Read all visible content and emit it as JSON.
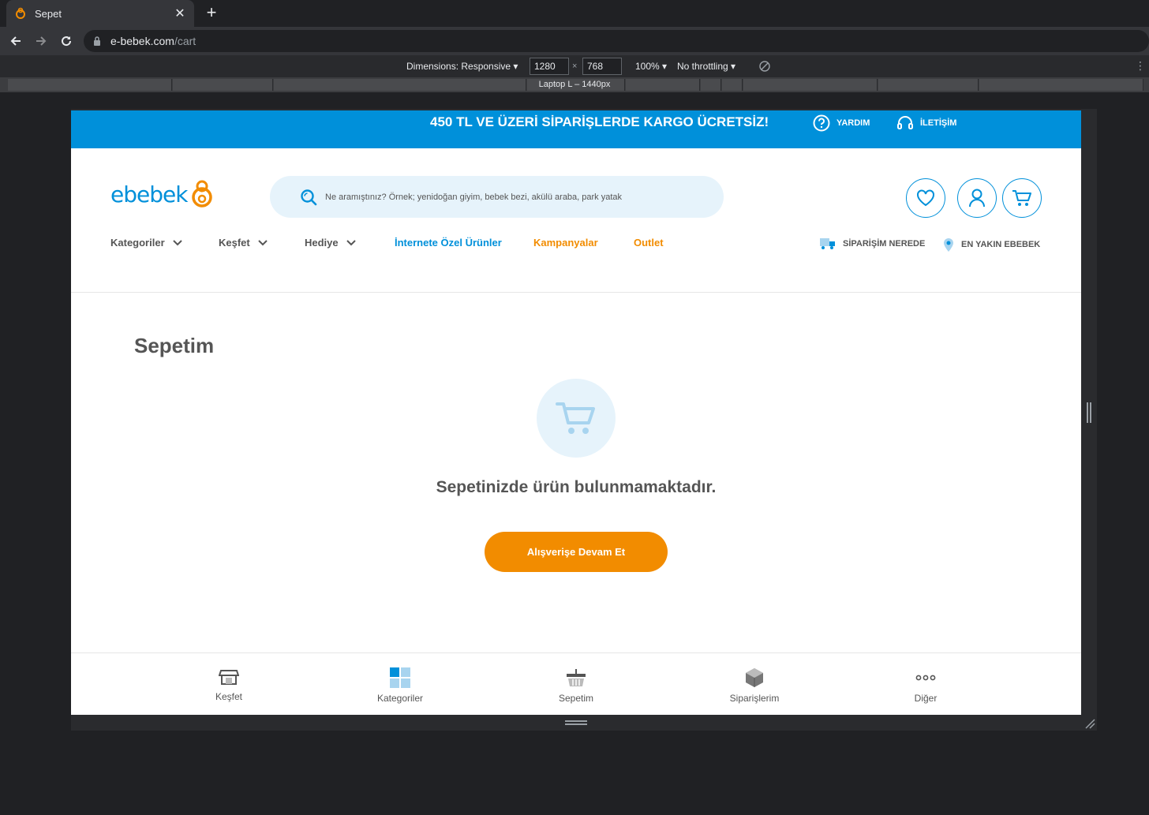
{
  "browser": {
    "tab_title": "Sepet",
    "url_host": "e-bebek.com",
    "url_path": "/cart"
  },
  "devtools": {
    "dimensions_label": "Dimensions: Responsive ▾",
    "width": "1280",
    "height": "768",
    "times": "×",
    "zoom": "100% ▾",
    "throttling": "No throttling ▾",
    "breakpoint_label": "Laptop L – 1440px"
  },
  "promo": {
    "text": "450 TL VE ÜZERİ SİPARİŞLERDE KARGO ÜCRETSİZ!",
    "help": "YARDIM",
    "contact": "İLETİŞİM"
  },
  "header": {
    "logo": "ebebek",
    "search_placeholder": "Ne aramıştınız? Örnek; yenidoğan giyim, bebek bezi, akülü araba, park yatak"
  },
  "nav": {
    "categories": "Kategoriler",
    "discover": "Keşfet",
    "gift": "Hediye",
    "online_exclusive": "İnternete Özel Ürünler",
    "campaigns": "Kampanyalar",
    "outlet": "Outlet",
    "order_tracking": "SİPARİŞİM NEREDE",
    "nearest_store": "EN YAKIN EBEBEK"
  },
  "cart": {
    "title": "Sepetim",
    "empty_message": "Sepetinizde ürün bulunmamaktadır.",
    "continue_button": "Alışverişe Devam Et"
  },
  "bottom_nav": {
    "items": [
      {
        "label": "Keşfet",
        "icon": "store-icon"
      },
      {
        "label": "Kategoriler",
        "icon": "grid-icon"
      },
      {
        "label": "Sepetim",
        "icon": "basket-icon"
      },
      {
        "label": "Siparişlerim",
        "icon": "package-icon"
      },
      {
        "label": "Diğer",
        "icon": "more-icon"
      }
    ]
  },
  "colors": {
    "brand_blue": "#0090da",
    "brand_orange": "#f28c00",
    "text_gray": "#555555",
    "light_blue": "#e6f3fb"
  }
}
